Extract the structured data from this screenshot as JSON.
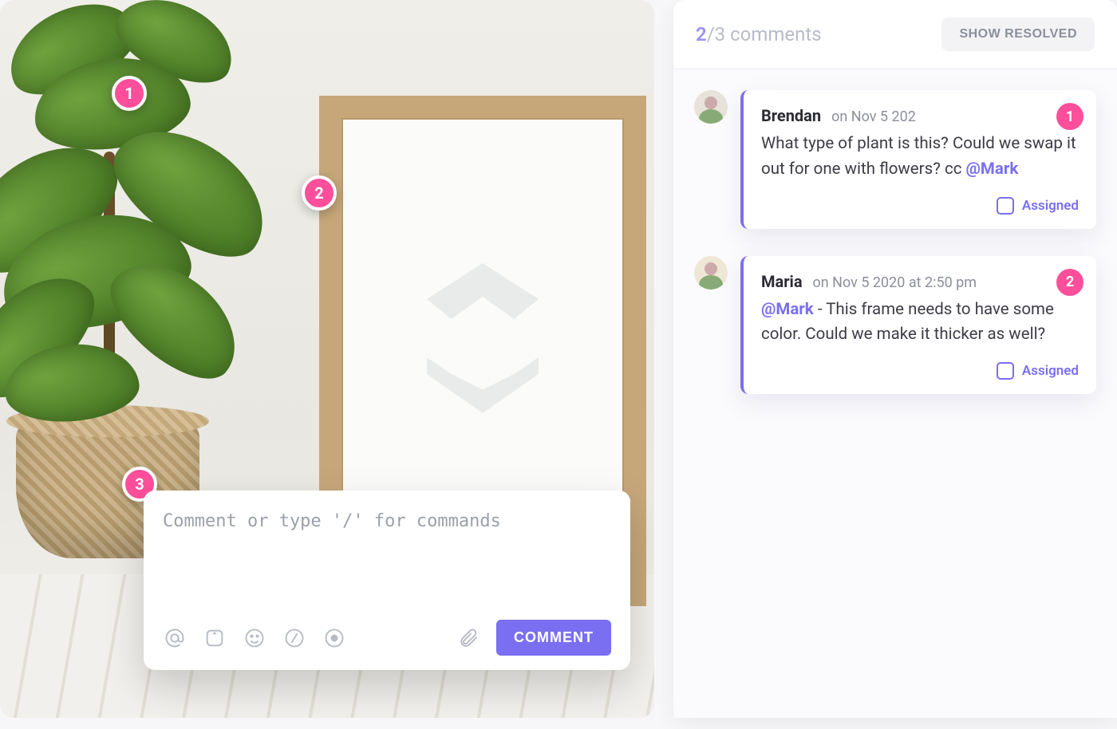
{
  "annotations": {
    "pin1": "1",
    "pin2": "2",
    "pin3": "3"
  },
  "composer": {
    "placeholder": "Comment or type '/' for commands",
    "submit_label": "COMMENT"
  },
  "panel": {
    "count_current": "2",
    "count_sep": "/",
    "count_total": "3 comments",
    "show_resolved": "SHOW RESOLVED"
  },
  "comments": [
    {
      "author": "Brendan",
      "date": "on Nov 5 202",
      "pin": "1",
      "body_pre": "What type of plant is this? Could we swap it out for one with flowers? cc ",
      "mention": "@Mark",
      "body_post": "",
      "assigned_label": "Assigned"
    },
    {
      "author": "Maria",
      "date": "on Nov 5 2020 at 2:50 pm",
      "pin": "2",
      "body_pre": "",
      "mention": "@Mark",
      "body_post": " - This frame needs to have some color. Could we make it thicker as well?",
      "assigned_label": "Assigned"
    }
  ]
}
